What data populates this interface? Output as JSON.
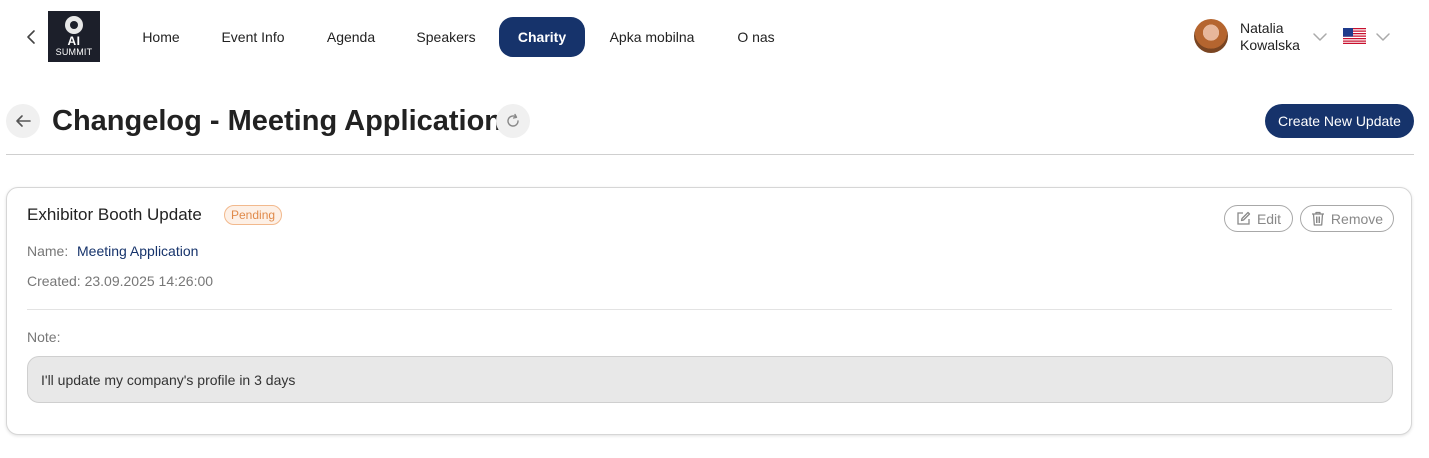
{
  "nav": {
    "back_icon": "chevron-left-icon",
    "logo": {
      "line1": "AI",
      "line2": "SUMMIT"
    },
    "items": [
      {
        "label": "Home",
        "active": false
      },
      {
        "label": "Event Info",
        "active": false
      },
      {
        "label": "Agenda",
        "active": false
      },
      {
        "label": "Speakers",
        "active": false
      },
      {
        "label": "Charity",
        "active": true
      },
      {
        "label": "Apka mobilna",
        "active": false
      },
      {
        "label": "O nas",
        "active": false
      }
    ],
    "active_color": "#16336b",
    "user": {
      "first_name": "Natalia",
      "last_name": "Kowalska"
    },
    "language_flag": "us-flag-icon"
  },
  "header": {
    "title": "Changelog - Meeting Application",
    "create_button": "Create New Update"
  },
  "card": {
    "title": "Exhibitor Booth Update",
    "status": "Pending",
    "name_label": "Name:",
    "name_value": "Meeting Application",
    "created": "Created: 23.09.2025 14:26:00",
    "edit_label": "Edit",
    "remove_label": "Remove",
    "note_label": "Note:",
    "note_text": "I'll update my company's profile in 3 days"
  },
  "colors": {
    "primary": "#16336b",
    "badge_text": "#e08a4a",
    "badge_bg": "#fdf0e6"
  }
}
